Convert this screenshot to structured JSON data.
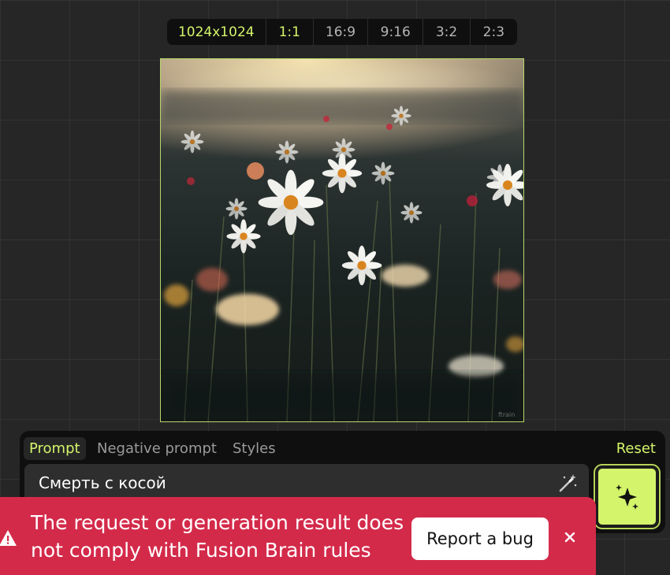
{
  "aspect_ratios": {
    "resolution": "1024x1024",
    "options": [
      "1:1",
      "16:9",
      "9:16",
      "3:2",
      "2:3"
    ],
    "selected": "1:1"
  },
  "image": {
    "description_icon": "generated-image",
    "watermark": "ftrain"
  },
  "prompt_panel": {
    "tabs": {
      "prompt": "Prompt",
      "negative": "Negative prompt",
      "styles": "Styles"
    },
    "reset_label": "Reset",
    "prompt_value": "Смерть с косой",
    "magic_icon": "magic-wand-icon",
    "generate_icon": "sparkle-icon"
  },
  "toast": {
    "message": "The request or generation result does not comply with Fusion Brain rules",
    "report_label": "Report a bug",
    "close_symbol": "×",
    "icon": "warning-icon"
  },
  "colors": {
    "accent": "#d4f56b",
    "error": "#d42a4a",
    "panel": "#0f0f0f",
    "background": "#262626"
  }
}
